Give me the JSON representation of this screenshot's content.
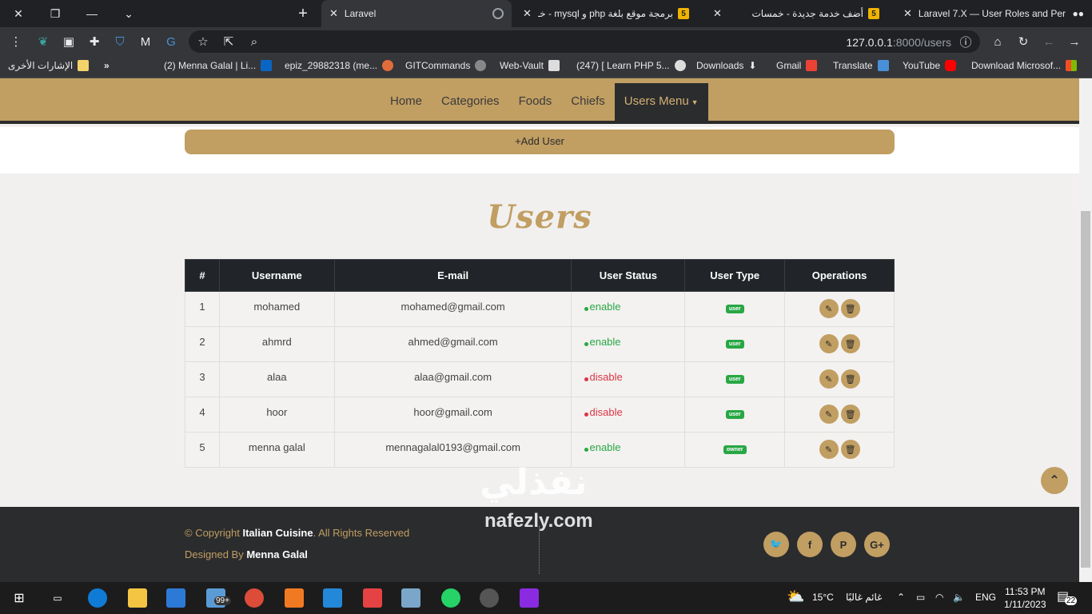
{
  "browser": {
    "tabs": [
      {
        "label": "Laravel",
        "active": true
      },
      {
        "label": "برمجة موقع بلغة php و mysql - خـ",
        "badge": "5"
      },
      {
        "label": "أضف خدمة جديدة - خمسات",
        "badge": "5"
      },
      {
        "label": "Laravel 7.X — User Roles and Per"
      }
    ],
    "new_tab": "+",
    "url_host": "127.0.0.1",
    "url_path": ":8000/users",
    "bookmarks": {
      "other": "الإشارات الأخرى",
      "more": "»",
      "items": [
        "(2) Menna Galal | Li...",
        "epiz_29882318 (me...",
        "GITCommands",
        "Web-Vault",
        "(247) [ Learn PHP 5...",
        "Downloads",
        "Gmail",
        "Translate",
        "YouTube",
        "Download Microsof..."
      ]
    }
  },
  "nav": {
    "items": [
      "Home",
      "Categories",
      "Foods",
      "Chiefs"
    ],
    "active": "Users Menu",
    "chevron": "⌄"
  },
  "add_button": "+Add User",
  "page_title": "Users",
  "table": {
    "headers": [
      "#",
      "Username",
      "E-mail",
      "User Status",
      "User Type",
      "Operations"
    ],
    "rows": [
      {
        "id": "1",
        "username": "mohamed",
        "email": "mohamed@gmail.com",
        "status": "enable",
        "type": "user"
      },
      {
        "id": "2",
        "username": "ahmrd",
        "email": "ahmed@gmail.com",
        "status": "enable",
        "type": "user"
      },
      {
        "id": "3",
        "username": "alaa",
        "email": "alaa@gmail.com",
        "status": "disable",
        "type": "user"
      },
      {
        "id": "4",
        "username": "hoor",
        "email": "hoor@gmail.com",
        "status": "disable",
        "type": "user"
      },
      {
        "id": "5",
        "username": "menna galal",
        "email": "mennagalal0193@gmail.com",
        "status": "enable",
        "type": "owner"
      }
    ]
  },
  "footer": {
    "copyright_prefix": "© Copyright",
    "site_name": "Italian Cuisine",
    "rights": ". All Rights Reserved",
    "designed_prefix": "Designed By",
    "designer": "Menna Galal",
    "social": [
      "twitter-icon",
      "facebook-icon",
      "pinterest-icon",
      "google-plus-icon"
    ],
    "social_glyphs": [
      "🐦",
      "f",
      "P",
      "G+"
    ]
  },
  "watermark": {
    "arabic": "نفذلي",
    "latin": "nafezly.com"
  },
  "taskbar": {
    "weather": "15°C",
    "weather_text": "غائم غالبًا",
    "lang": "ENG",
    "time": "11:53 PM",
    "date": "1/11/2023",
    "notif_count": "22",
    "mail_badge": "99+"
  },
  "colors": {
    "brand": "#c19e62",
    "dark": "#2b2c2e",
    "enable": "#28a745",
    "disable": "#dc3545"
  }
}
